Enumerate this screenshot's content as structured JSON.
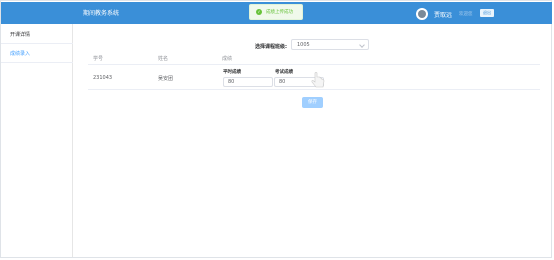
{
  "header": {
    "app_title": "期间教务系统",
    "toast_text": "成绩上传成功",
    "user_name": "贾取远",
    "user_role": "欢迎您",
    "logout_label": "退出"
  },
  "sidebar": {
    "items": [
      {
        "label": "开课详情"
      },
      {
        "label": "成绩录入",
        "active": true
      }
    ]
  },
  "main": {
    "course_select_label": "选择课程班级:",
    "course_select_value": "1005",
    "columns": [
      "学号",
      "姓名",
      "成绩"
    ],
    "rows": [
      {
        "student_id": "231043",
        "name": "吴安团",
        "usual_label": "平时成绩",
        "usual_value": "80",
        "exam_label": "考试成绩",
        "exam_value": "80"
      }
    ],
    "save_label": "保存"
  },
  "colors": {
    "header_bg": "#3a8fd8",
    "accent": "#409eff",
    "success": "#67c23a",
    "button_disabled": "#a0cfff"
  }
}
